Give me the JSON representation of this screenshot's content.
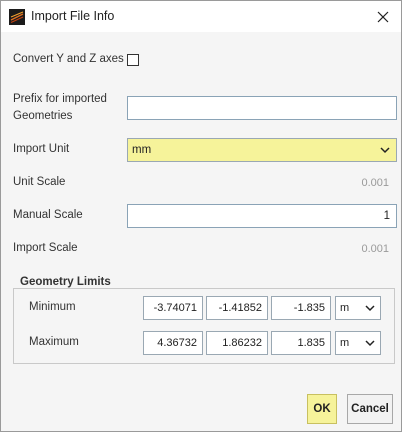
{
  "window": {
    "title": "Import File Info",
    "app_icon": "app-logo-icon",
    "close_icon": "close-icon"
  },
  "form": {
    "convert_axes_label": "Convert Y and Z axes",
    "convert_axes_checked": false,
    "prefix_label_line1": "Prefix for imported",
    "prefix_label_line2": "Geometries",
    "prefix_value": "",
    "import_unit_label": "Import Unit",
    "import_unit_value": "mm",
    "unit_scale_label": "Unit Scale",
    "unit_scale_value": "0.001",
    "manual_scale_label": "Manual Scale",
    "manual_scale_value": "1",
    "import_scale_label": "Import Scale",
    "import_scale_value": "0.001"
  },
  "geometry_limits": {
    "title": "Geometry Limits",
    "minimum": {
      "label": "Minimum",
      "x": "-3.74071",
      "y": "-1.41852",
      "z": "-1.835",
      "unit": "m"
    },
    "maximum": {
      "label": "Maximum",
      "x": "4.36732",
      "y": "1.86232",
      "z": "1.835",
      "unit": "m"
    }
  },
  "buttons": {
    "ok": "OK",
    "cancel": "Cancel"
  },
  "colors": {
    "highlight": "#f6f39a",
    "negative": "#c04040",
    "input_border": "#9aa8b3"
  }
}
